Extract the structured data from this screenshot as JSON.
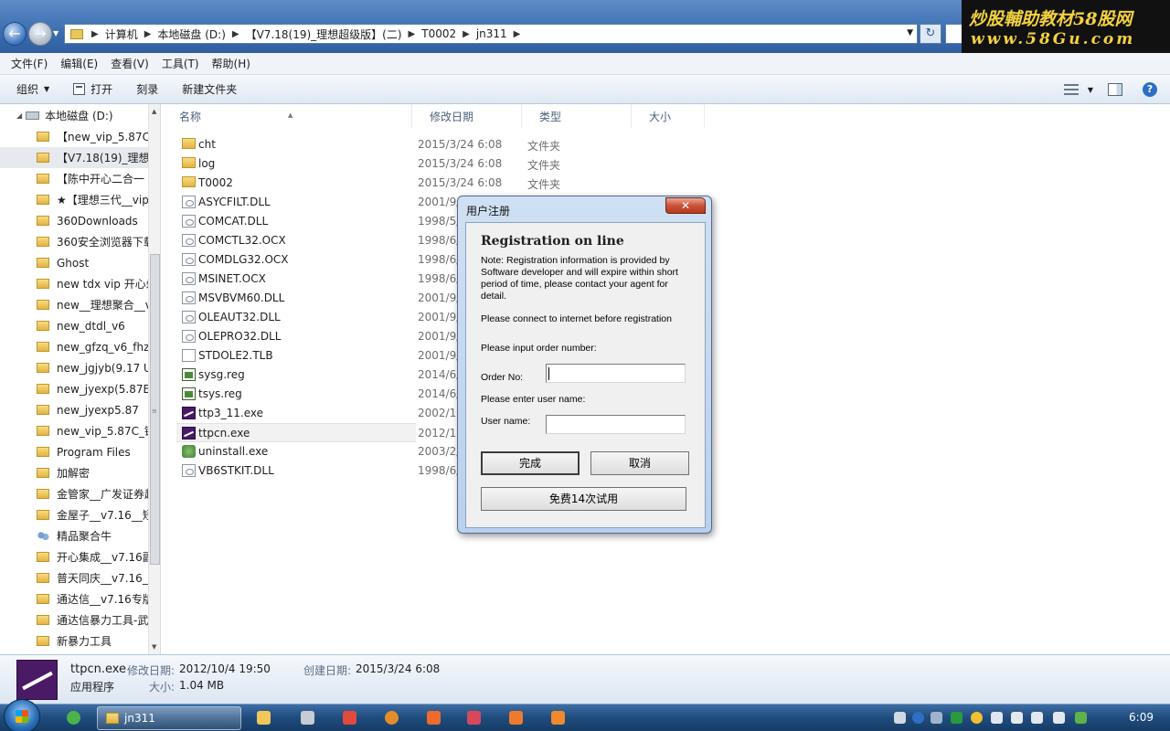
{
  "address": {
    "crumbs": [
      "计算机",
      "本地磁盘 (D:)",
      "【V7.18(19)_理想超级版】(二)",
      "T0002",
      "jn311"
    ]
  },
  "watermark": {
    "line1": "炒股輔助教材58股网",
    "line2": "www.58Gu.com"
  },
  "menu": [
    "文件(F)",
    "编辑(E)",
    "查看(V)",
    "工具(T)",
    "帮助(H)"
  ],
  "toolbar": {
    "organize": "组织",
    "open": "打开",
    "burn": "刻录",
    "new_folder": "新建文件夹"
  },
  "navpane": {
    "drive": "本地磁盘 (D:)",
    "items": [
      "【new_vip_5.87C_",
      "【V7.18(19)_理想超",
      "【陈中开心二合一",
      "★【理想三代__vip",
      "360Downloads",
      "360安全浏览器下载",
      "Ghost",
      "new tdx vip 开心剁",
      "new__理想聚合__v",
      "new_dtdl_v6",
      "new_gfzq_v6_fhzx",
      "new_jgjyb(9.17 U",
      "new_jyexp(5.87B)",
      "new_jyexp5.87",
      "new_vip_5.87C_键",
      "Program Files",
      "加解密",
      "金管家__广发证券超",
      "金屋子__v7.16__短",
      "精品聚合牛",
      "开心集成__v7.16副",
      "普天同庆__v7.16_",
      "通达信__v7.16专版",
      "通达信暴力工具-武",
      "新暴力工具"
    ]
  },
  "columns": {
    "name": "名称",
    "date": "修改日期",
    "type": "类型",
    "size": "大小"
  },
  "files": [
    {
      "name": "cht",
      "date": "2015/3/24 6:08",
      "type": "文件夹",
      "icon": "folder-icon"
    },
    {
      "name": "log",
      "date": "2015/3/24 6:08",
      "type": "文件夹",
      "icon": "folder-icon"
    },
    {
      "name": "T0002",
      "date": "2015/3/24 6:08",
      "type": "文件夹",
      "icon": "folder-icon"
    },
    {
      "name": "ASYCFILT.DLL",
      "date": "2001/9/",
      "type": "",
      "icon": "dll-icon"
    },
    {
      "name": "COMCAT.DLL",
      "date": "1998/5/",
      "type": "",
      "icon": "dll-icon"
    },
    {
      "name": "COMCTL32.OCX",
      "date": "1998/6/",
      "type": "",
      "icon": "dll-icon"
    },
    {
      "name": "COMDLG32.OCX",
      "date": "1998/6/",
      "type": "",
      "icon": "dll-icon"
    },
    {
      "name": "MSINET.OCX",
      "date": "1998/6/",
      "type": "",
      "icon": "dll-icon"
    },
    {
      "name": "MSVBVM60.DLL",
      "date": "2001/9/",
      "type": "",
      "icon": "dll-icon"
    },
    {
      "name": "OLEAUT32.DLL",
      "date": "2001/9/",
      "type": "",
      "icon": "dll-icon"
    },
    {
      "name": "OLEPRO32.DLL",
      "date": "2001/9/",
      "type": "",
      "icon": "dll-icon"
    },
    {
      "name": "STDOLE2.TLB",
      "date": "2001/9/",
      "type": "",
      "icon": "tlb-icon"
    },
    {
      "name": "sysg.reg",
      "date": "2014/6/",
      "type": "",
      "icon": "reg-icon"
    },
    {
      "name": "tsys.reg",
      "date": "2014/6/",
      "type": "",
      "icon": "reg-icon"
    },
    {
      "name": "ttp3_11.exe",
      "date": "2002/11",
      "type": "",
      "icon": "exe-icon"
    },
    {
      "name": "ttpcn.exe",
      "date": "2012/10",
      "type": "",
      "icon": "exe-icon"
    },
    {
      "name": "uninstall.exe",
      "date": "2003/2/",
      "type": "",
      "icon": "uninstall-icon"
    },
    {
      "name": "VB6STKIT.DLL",
      "date": "1998/6/",
      "type": "",
      "icon": "dll-icon"
    }
  ],
  "dialog": {
    "title": "用户注册",
    "close": "✕",
    "heading": "Registration on line",
    "note": "Note: Registration information is provided by Software developer and will expire within short period of time, please contact your agent for detail.",
    "connect": "Please connect to internet before registration",
    "order_prompt": "Please input order number:",
    "order_label": "Order No:",
    "order_value": "",
    "user_prompt": "Please enter user name:",
    "user_label": "User name:",
    "user_value": "",
    "ok": "完成",
    "cancel": "取消",
    "trial": "免费14次试用"
  },
  "details": {
    "name": "ttpcn.exe",
    "kind": "应用程序",
    "modified_label": "修改日期:",
    "modified": "2012/10/4 19:50",
    "created_label": "创建日期:",
    "created": "2015/3/24 6:08",
    "size_label": "大小:",
    "size": "1.04 MB"
  },
  "taskbar": {
    "window_label": "jn311",
    "clock": "6:09"
  }
}
